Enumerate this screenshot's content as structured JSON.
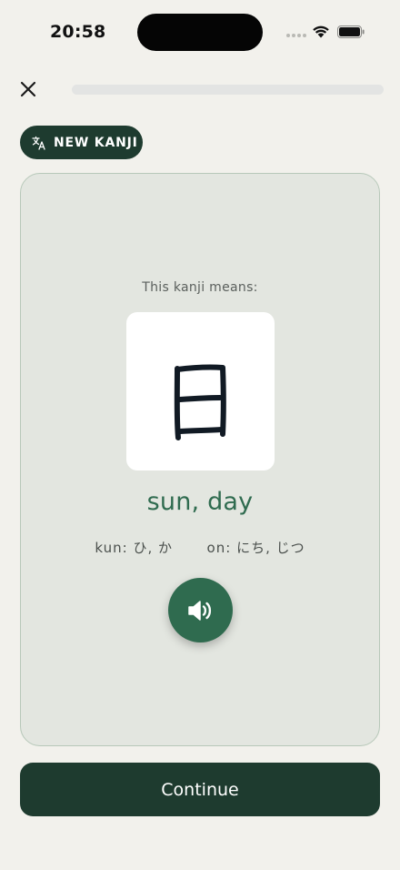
{
  "status_bar": {
    "time": "20:58"
  },
  "lesson": {
    "progress": 0,
    "badge_label": "NEW KANJI",
    "badge_icon": "translate-icon"
  },
  "card": {
    "prompt": "This kanji means:",
    "kanji": "日",
    "meaning": "sun, day",
    "kun_label": "kun:",
    "kun_reading": "ひ, か",
    "on_label": "on:",
    "on_reading": "にち, じつ",
    "audio_icon": "speaker-icon"
  },
  "continue_label": "Continue",
  "colors": {
    "background": "#f2f1ec",
    "dark_green": "#1e3b2f",
    "accent_green": "#2f6b4f",
    "card_bg": "#e3e6e0",
    "card_border": "#b7c8b9"
  }
}
